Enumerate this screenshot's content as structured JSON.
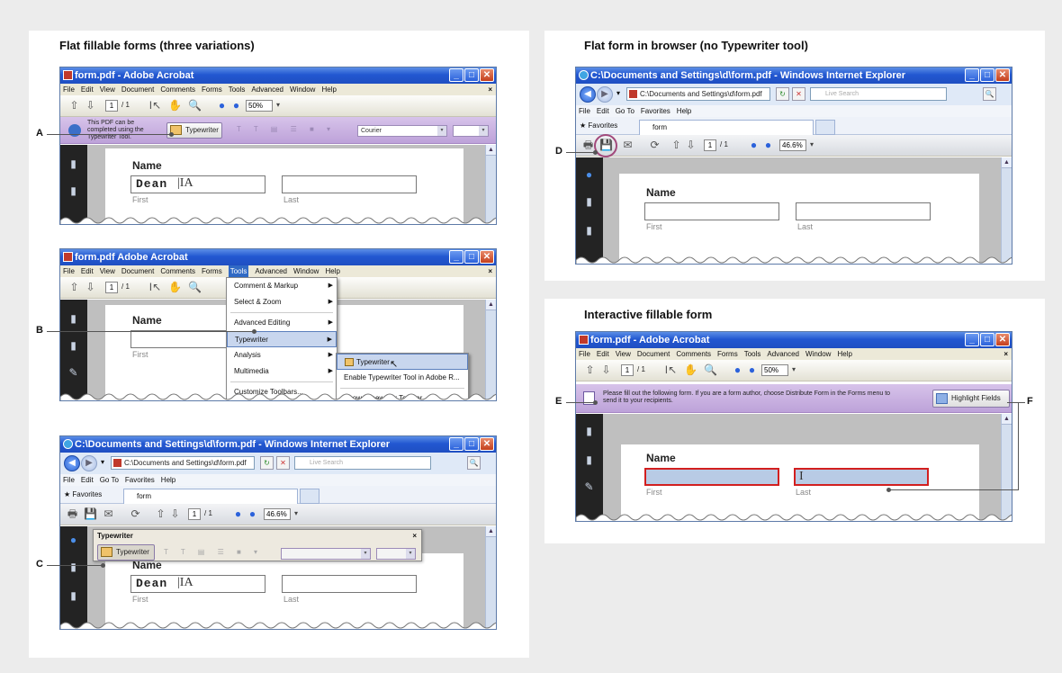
{
  "panels": {
    "flat_forms": {
      "title": "Flat fillable forms (three variations)"
    },
    "browser": {
      "title": "Flat form in browser (no Typewriter tool)"
    },
    "interactive": {
      "title": "Interactive fillable form"
    }
  },
  "callouts": {
    "a": "A",
    "b": "B",
    "c": "C",
    "d": "D",
    "e": "E",
    "f": "F"
  },
  "acrobat": {
    "title": "form.pdf - Adobe Acrobat",
    "title_alt": "form.pdf  Adobe Acrobat",
    "menu": [
      "File",
      "Edit",
      "View",
      "Document",
      "Comments",
      "Forms",
      "Tools",
      "Advanced",
      "Window",
      "Help"
    ],
    "menu_close": "×",
    "page_num": "1",
    "page_total": "/ 1",
    "zoom": "50%",
    "zoom_drop": "▾"
  },
  "ie": {
    "title": "C:\\Documents and Settings\\d\\form.pdf - Windows Internet Explorer",
    "address": "C:\\Documents and Settings\\d\\form.pdf",
    "search_placeholder": "Live Search",
    "menu": [
      "File",
      "Edit",
      "Go To",
      "Favorites",
      "Help"
    ],
    "favorites": "Favorites",
    "tab": "form",
    "page_num": "1",
    "page_total": "/ 1",
    "zoom": "46.6%",
    "zoom_drop": "▾"
  },
  "typewriter_bar": {
    "message": "This PDF can be completed using the Typewriter Tool.",
    "button": "Typewriter",
    "font": "Courier"
  },
  "tools_menu": {
    "items": [
      "Comment & Markup",
      "Select & Zoom",
      "Advanced Editing",
      "Typewriter",
      "Analysis",
      "Multimedia",
      "Customize Toolbars..."
    ],
    "submenu": [
      "Typewriter",
      "Enable Typewriter Tool in Adobe R...",
      "Show Typewriter Toolbar"
    ]
  },
  "typewriter_panel": {
    "title": "Typewriter",
    "button": "Typewriter",
    "close": "×"
  },
  "form": {
    "name_label": "Name",
    "first_label": "First",
    "last_label": "Last",
    "typed_value": "Dean",
    "cursor_glyph": "|IA"
  },
  "interactive_bar": {
    "message": "Please fill out the following form. If you are a form author, choose Distribute Form in the Forms menu to send it to your recipients.",
    "highlight_button": "Highlight Fields"
  },
  "colors": {
    "purple_bar": "#c9b1e2",
    "highlight_border": "#d21f1f",
    "field_fill": "#b8cbe5",
    "xp_blue": "#2257d1"
  }
}
